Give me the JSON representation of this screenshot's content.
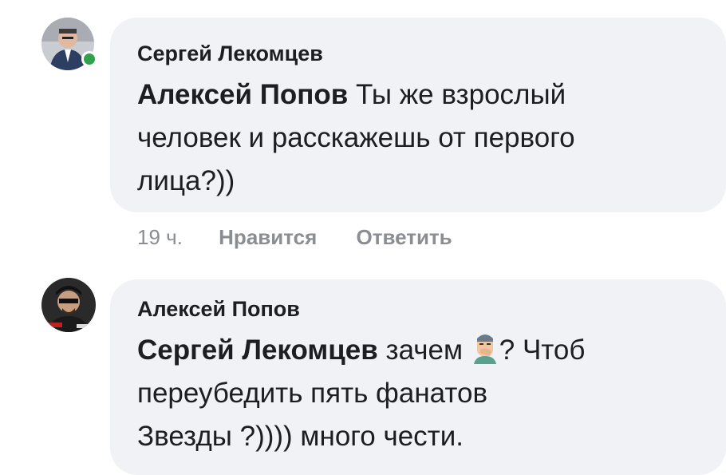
{
  "comments": [
    {
      "author": "Сергей Лекомцев",
      "mention": "Алексей Попов",
      "text_line1": " Ты же взрослый",
      "text_line2": "человек и расскажешь от первого",
      "text_line3": "лица?))",
      "time": "19 ч.",
      "like_label": "Нравится",
      "reply_label": "Ответить",
      "online": true
    },
    {
      "author": "Алексей Попов",
      "mention": "Сергей Лекомцев",
      "text_line1a": " зачем ",
      "emoji": "face-with-hand-over-mouth-emoji",
      "text_line1b": "? Чтоб",
      "text_line2": "переубедить пять фанатов",
      "text_line3": "Звезды ?)))) много чести."
    }
  ],
  "colors": {
    "bubble": "#f0f2f5",
    "text": "#1c1e21",
    "meta": "#8a8d91",
    "online": "#31a24c"
  }
}
